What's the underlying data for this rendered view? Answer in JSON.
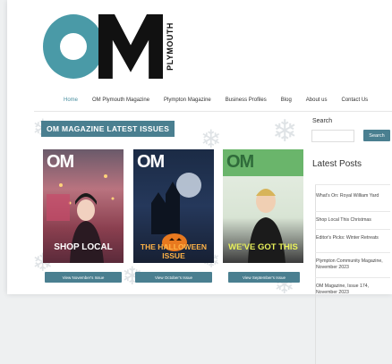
{
  "logo": {
    "letters": "OM",
    "side_text": "PLYMOUTH"
  },
  "nav": {
    "items": [
      {
        "label": "Home",
        "active": true
      },
      {
        "label": "OM Plymouth Magazine",
        "active": false
      },
      {
        "label": "Plympton Magazine",
        "active": false
      },
      {
        "label": "Business Profiles",
        "active": false
      },
      {
        "label": "Blog",
        "active": false
      },
      {
        "label": "About us",
        "active": false
      },
      {
        "label": "Contact Us",
        "active": false
      }
    ]
  },
  "main": {
    "heading": "OM MAGAZINE LATEST ISSUES",
    "covers": [
      {
        "mast": "OM",
        "headline": "SHOP LOCAL",
        "button": "View November's Issue"
      },
      {
        "mast": "OM",
        "headline": "THE HALLOWEEN ISSUE",
        "button": "View October's Issue"
      },
      {
        "mast": "OM",
        "headline": "WE'VE GOT THIS",
        "button": "View September's Issue"
      }
    ]
  },
  "sidebar": {
    "search_label": "Search",
    "search_placeholder": "",
    "search_button": "Search",
    "latest_heading": "Latest Posts",
    "posts": [
      "What's On: Royal William Yard",
      "Shop Local This Christmas",
      "Editor's Picks: Winter Retreats",
      "Plympton Community Magazine, November 2023",
      "OM Magazine, Issue 174, November 2023"
    ]
  },
  "colors": {
    "accent": "#4a7f90",
    "logo_teal": "#4a9aa7"
  }
}
